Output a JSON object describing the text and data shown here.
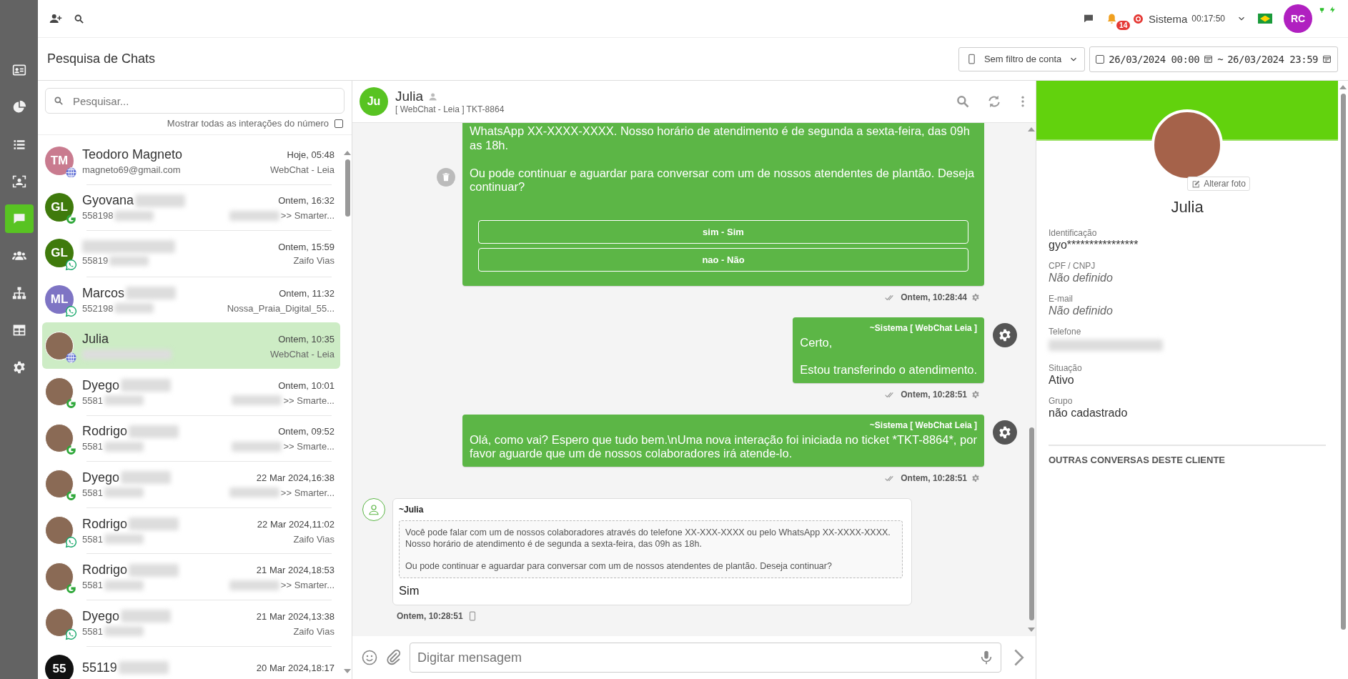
{
  "nav": {
    "items": [
      {
        "selected": false
      },
      {
        "selected": false
      },
      {
        "selected": false
      },
      {
        "selected": false
      },
      {
        "selected": true
      },
      {
        "selected": false
      },
      {
        "selected": false
      },
      {
        "selected": false
      },
      {
        "selected": false
      }
    ]
  },
  "topbar": {
    "notifications": "14",
    "user_name": "Sistema",
    "timer": "00:17:50",
    "avatar_initials": "RC"
  },
  "page": {
    "title": "Pesquisa de Chats",
    "account_filter": "Sem filtro de conta",
    "date_filter_checked": false,
    "date_from": "26/03/2024 00:00",
    "date_separator": "~",
    "date_to": "26/03/2024 23:59"
  },
  "chat_list": {
    "search_placeholder": "Pesquisar...",
    "show_all_label": "Mostrar todas as interações do número",
    "show_all_checked": false,
    "rows": [
      {
        "kind": "web",
        "name": "Teodoro Magneto",
        "name_redacted": false,
        "initials": "TM",
        "color": "#c97b8f",
        "sub": "magneto69@gmail.com",
        "sub_redacted": false,
        "time": "Hoje, 05:48",
        "source": "WebChat - Leia",
        "source_redacted": false,
        "selected": false
      },
      {
        "kind": "smarter",
        "name": "Gyovana",
        "name_redacted": true,
        "initials": "GL",
        "color": "#3f7a0c",
        "sub": "558198",
        "sub_redacted": true,
        "time": "Ontem, 16:32",
        "source": ">> Smarter...",
        "source_redacted": true,
        "selected": false
      },
      {
        "kind": "whatsapp",
        "name_redacted": true,
        "initials": "GL",
        "color": "#3f7a0c",
        "sub": "55819",
        "sub_redacted": true,
        "time": "Ontem, 15:59",
        "source": "Zaifo Vias",
        "source_redacted": false,
        "selected": false
      },
      {
        "kind": "whatsapp",
        "name": "Marcos",
        "name_redacted": true,
        "initials": "ML",
        "color": "#7e74c4",
        "sub": "552198",
        "sub_redacted": true,
        "time": "Ontem, 11:32",
        "source": "Nossa_Praia_Digital_55...",
        "source_redacted": false,
        "selected": false
      },
      {
        "kind": "web",
        "name": "Julia",
        "name_redacted": false,
        "sub_redacted": true,
        "time": "Ontem, 10:35",
        "source": "WebChat - Leia",
        "source_redacted": false,
        "selected": true
      },
      {
        "kind": "smarter",
        "name": "Dyego",
        "name_redacted": true,
        "sub": "5581",
        "sub_redacted": true,
        "time": "Ontem, 10:01",
        "source": ">> Smarte...",
        "source_redacted": true,
        "selected": false
      },
      {
        "kind": "smarter",
        "name": "Rodrigo",
        "name_redacted": true,
        "sub": "5581",
        "sub_redacted": true,
        "time": "Ontem, 09:52",
        "source": ">> Smarte...",
        "source_redacted": true,
        "selected": false
      },
      {
        "kind": "smarter",
        "name": "Dyego",
        "name_redacted": true,
        "sub": "5581",
        "sub_redacted": true,
        "time": "22 Mar 2024,16:38",
        "source": ">> Smarter...",
        "source_redacted": true,
        "selected": false
      },
      {
        "kind": "whatsapp",
        "name": "Rodrigo",
        "name_redacted": true,
        "sub": "5581",
        "sub_redacted": true,
        "time": "22 Mar 2024,11:02",
        "source": "Zaifo Vias",
        "source_redacted": false,
        "selected": false
      },
      {
        "kind": "smarter",
        "name": "Rodrigo",
        "name_redacted": true,
        "sub": "5581",
        "sub_redacted": true,
        "time": "21 Mar 2024,18:53",
        "source": ">> Smarter...",
        "source_redacted": true,
        "selected": false
      },
      {
        "kind": "whatsapp",
        "name": "Dyego",
        "name_redacted": true,
        "sub": "5581",
        "sub_redacted": true,
        "time": "21 Mar 2024,13:38",
        "source": "Zaifo Vias",
        "source_redacted": false,
        "selected": false
      },
      {
        "kind": "none",
        "name": "55119",
        "name_redacted": true,
        "initials": "55",
        "color": "#111111",
        "sub_redacted": false,
        "time": "20 Mar 2024,18:17",
        "source_redacted": false,
        "selected": false
      }
    ]
  },
  "chat": {
    "avatar_initials": "Ju",
    "name": "Julia",
    "subtitle": "[ WebChat - Leia ] TKT-8864",
    "input_placeholder": "Digitar mensagem",
    "messages": [
      {
        "kind": "outgoing",
        "paragraphs": [
          "WhatsApp XX-XXXX-XXXX. Nosso horário de atendimento é de segunda a sexta-feira, das 09h as 18h.",
          "Ou pode continuar e aguardar para conversar com um de nossos atendentes de plantão. Deseja continuar?"
        ],
        "buttons": [
          "sim - Sim",
          "nao - Não"
        ],
        "time": "Ontem, 10:28:44"
      },
      {
        "kind": "outgoing",
        "sender": "~Sistema [ WebChat Leia ]",
        "paragraphs": [
          "Certo,",
          "Estou transferindo o atendimento."
        ],
        "time": "Ontem, 10:28:51"
      },
      {
        "kind": "outgoing",
        "sender": "~Sistema [ WebChat Leia ]",
        "paragraphs": [
          "Olá, como vai? Espero que tudo bem.\\nUma nova interação foi iniciada no ticket *TKT-8864*, por favor aguarde que um de nossos colaboradores irá atende-lo."
        ],
        "time": "Ontem, 10:28:51"
      },
      {
        "kind": "incoming",
        "sender": "~Julia",
        "quote": [
          "Você pode falar com um de nossos colaboradores através do telefone XX-XXX-XXXX ou pelo WhatsApp XX-XXXX-XXXX. Nosso horário de atendimento é de segunda a sexta-feira, das 09h as 18h.",
          "Ou pode continuar e aguardar para conversar com um de nossos atendentes de plantão. Deseja continuar?"
        ],
        "paragraphs": [
          "Sim"
        ],
        "time": "Ontem, 10:28:51"
      }
    ]
  },
  "profile": {
    "change_photo": "Alterar foto",
    "name": "Julia",
    "fields": [
      {
        "label": "Identificação",
        "value": "gyo****************",
        "kind": "text"
      },
      {
        "label": "CPF / CNPJ",
        "value": "Não definido",
        "kind": "undefined"
      },
      {
        "label": "E-mail",
        "value": "Não definido",
        "kind": "undefined"
      },
      {
        "label": "Telefone",
        "kind": "redacted"
      },
      {
        "label": "Situação",
        "value": "Ativo",
        "kind": "text"
      },
      {
        "label": "Grupo",
        "value": "não cadastrado",
        "kind": "text"
      }
    ],
    "section_title": "OUTRAS CONVERSAS DESTE CLIENTE"
  }
}
